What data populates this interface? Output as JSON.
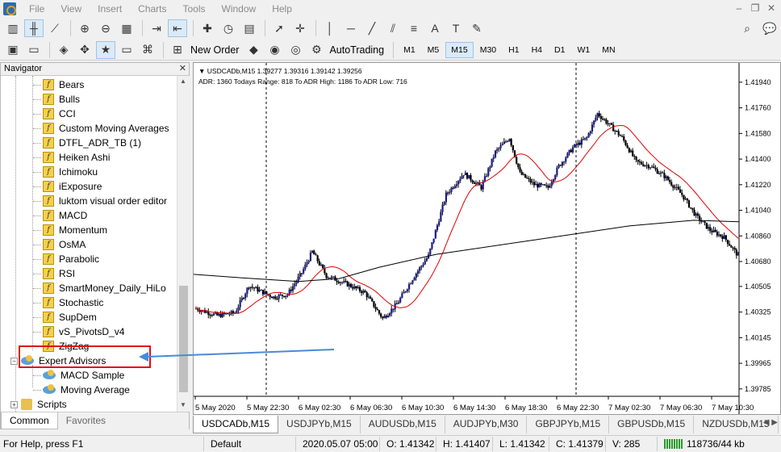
{
  "menu": {
    "items": [
      "File",
      "View",
      "Insert",
      "Charts",
      "Tools",
      "Window",
      "Help"
    ]
  },
  "toolbar": {
    "new_order": "New Order",
    "autotrading": "AutoTrading",
    "timeframes": [
      "M1",
      "M5",
      "M15",
      "M30",
      "H1",
      "H4",
      "D1",
      "W1",
      "MN"
    ],
    "active_tf": "M15"
  },
  "navigator": {
    "title": "Navigator",
    "indicators": [
      "Bears",
      "Bulls",
      "CCI",
      "Custom Moving Averages",
      "DTFL_ADR_TB  (1)",
      "Heiken Ashi",
      "Ichimoku",
      "iExposure",
      "luktom visual order editor",
      "MACD",
      "Momentum",
      "OsMA",
      "Parabolic",
      "RSI",
      "SmartMoney_Daily_HiLo",
      "Stochastic",
      "SupDem",
      "vS_PivotsD_v4",
      "ZigZag"
    ],
    "expert_advisors": "Expert Advisors",
    "ea_items": [
      "MACD Sample",
      "Moving Average"
    ],
    "scripts": "Scripts",
    "tabs": [
      "Common",
      "Favorites"
    ]
  },
  "chart": {
    "header": "USDCADb,M15  1.39277 1.39316 1.39142 1.39256",
    "subheader": "ADR: 1360  Todays Range: 818  To ADR High: 1186  To ADR Low: 716",
    "price_labels": [
      "1.41940",
      "1.41760",
      "1.41580",
      "1.41400",
      "1.41220",
      "1.41040",
      "1.40860",
      "1.40680",
      "1.40505",
      "1.40325",
      "1.40145",
      "1.39965",
      "1.39785"
    ],
    "time_labels": [
      "5 May 2020",
      "5 May 22:30",
      "6 May 02:30",
      "6 May 06:30",
      "6 May 10:30",
      "6 May 14:30",
      "6 May 18:30",
      "6 May 22:30",
      "7 May 02:30",
      "7 May 06:30",
      "7 May 10:30"
    ],
    "colors": {
      "bull": "#1a1a8c",
      "bear": "#000000",
      "ma_fast": "#e00000",
      "ma_slow": "#000000",
      "annotation_arrow": "#4a8ad8",
      "highlight_box": "#dd1111"
    }
  },
  "chart_tabs": [
    "USDCADb,M15",
    "USDJPYb,M15",
    "AUDUSDb,M15",
    "AUDJPYb,M30",
    "GBPJPYb,M15",
    "GBPUSDb,M15",
    "NZDUSDb,M15"
  ],
  "status": {
    "help": "For Help, press F1",
    "profile": "Default",
    "datetime": "2020.05.07 05:00",
    "open": "O: 1.41342",
    "high": "H: 1.41407",
    "low": "L: 1.41342",
    "close": "C: 1.41379",
    "volume": "V: 285",
    "traffic": "118736/44 kb"
  }
}
